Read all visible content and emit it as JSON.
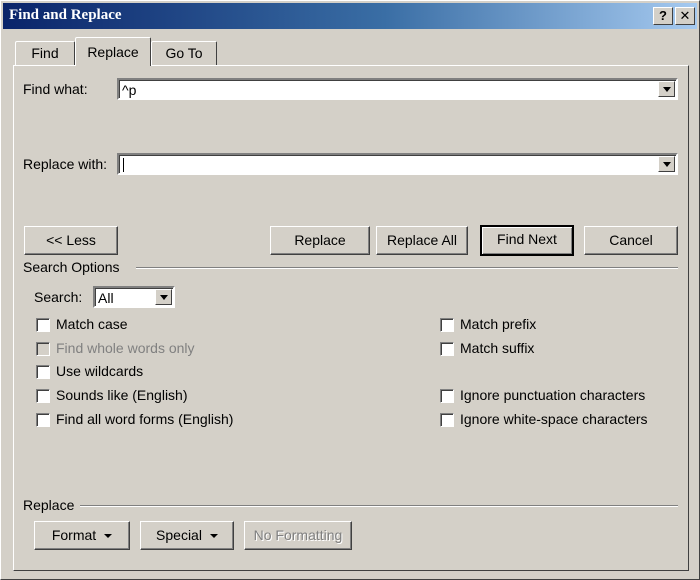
{
  "window": {
    "title": "Find and Replace",
    "help_label": "?",
    "close_label": "✕"
  },
  "tabs": [
    {
      "label": "Find",
      "active": false
    },
    {
      "label": "Replace",
      "active": true
    },
    {
      "label": "Go To",
      "active": false
    }
  ],
  "find": {
    "label": "Find what:",
    "value": "^p"
  },
  "replace": {
    "label": "Replace with:",
    "value": ""
  },
  "buttons": {
    "less": "<< Less",
    "replace": "Replace",
    "replace_all": "Replace All",
    "find_next": "Find Next",
    "cancel": "Cancel"
  },
  "search_options": {
    "heading": "Search Options",
    "search_label": "Search:",
    "search_value": "All",
    "left_options": [
      {
        "label": "Match case",
        "checked": false,
        "enabled": true
      },
      {
        "label": "Find whole words only",
        "checked": false,
        "enabled": false
      },
      {
        "label": "Use wildcards",
        "checked": false,
        "enabled": true
      },
      {
        "label": "Sounds like (English)",
        "checked": false,
        "enabled": true
      },
      {
        "label": "Find all word forms (English)",
        "checked": false,
        "enabled": true
      }
    ],
    "right_options": [
      {
        "label": "Match prefix",
        "checked": false,
        "enabled": true
      },
      {
        "label": "Match suffix",
        "checked": false,
        "enabled": true
      },
      {
        "label": "Ignore punctuation characters",
        "checked": false,
        "enabled": true
      },
      {
        "label": "Ignore white-space characters",
        "checked": false,
        "enabled": true
      }
    ]
  },
  "replace_section": {
    "heading": "Replace",
    "format_label": "Format",
    "special_label": "Special",
    "no_formatting_label": "No Formatting"
  }
}
